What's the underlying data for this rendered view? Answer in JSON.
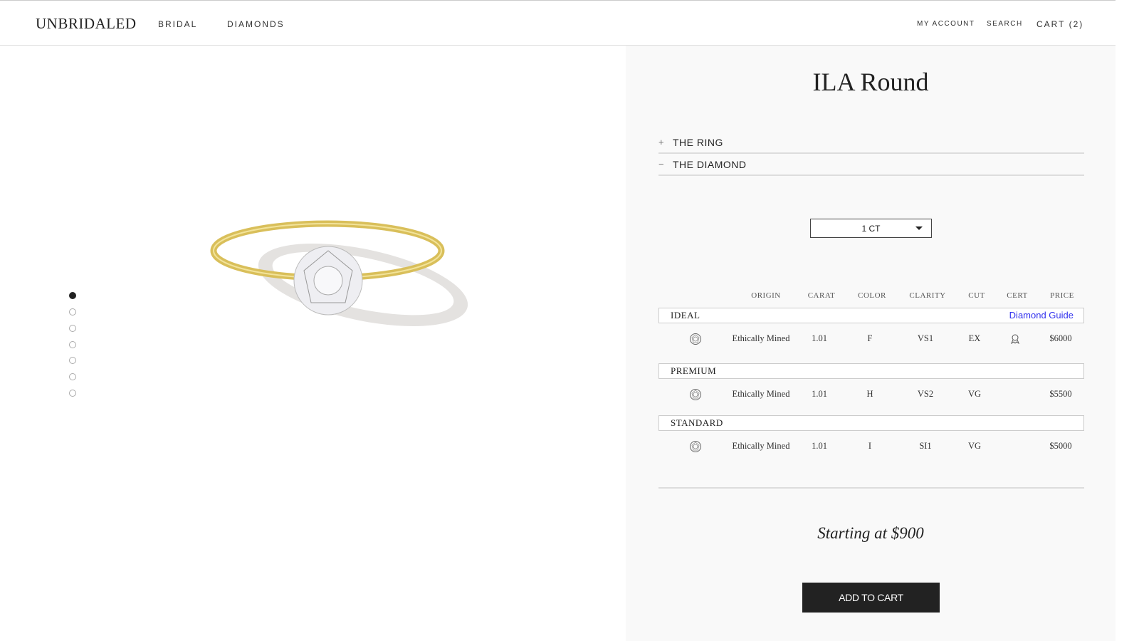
{
  "header": {
    "logo": "UNBRIDALED",
    "nav": [
      "BRIDAL",
      "DIAMONDS"
    ],
    "account": "MY ACCOUNT",
    "search": "SEARCH",
    "cart": "CART (2)"
  },
  "gallery": {
    "image_count": 7,
    "active_index": 0
  },
  "product": {
    "title": "ILA Round",
    "accordion": [
      {
        "sign": "+",
        "label": "THE RING"
      },
      {
        "sign": "−",
        "label": "THE DIAMOND"
      }
    ],
    "carat_select": "1 CT",
    "columns": [
      "ORIGIN",
      "CARAT",
      "COLOR",
      "CLARITY",
      "CUT",
      "CERT",
      "PRICE"
    ],
    "diamond_guide": "Diamond Guide",
    "groups": [
      {
        "name": "IDEAL",
        "row": {
          "icon": "diamond-icon",
          "origin": "Ethically Mined",
          "carat": "1.01",
          "color": "F",
          "clarity": "VS1",
          "cut": "EX",
          "cert": "certificate-ribbon-icon",
          "price": "$6000"
        }
      },
      {
        "name": "PREMIUM",
        "row": {
          "icon": "diamond-icon",
          "origin": "Ethically Mined",
          "carat": "1.01",
          "color": "H",
          "clarity": "VS2",
          "cut": "VG",
          "cert": "",
          "price": "$5500"
        }
      },
      {
        "name": "STANDARD",
        "row": {
          "icon": "diamond-icon",
          "origin": "Ethically Mined",
          "carat": "1.01",
          "color": "I",
          "clarity": "SI1",
          "cut": "VG",
          "cert": "",
          "price": "$5000"
        }
      }
    ],
    "starting_price": "Starting at $900",
    "add_to_cart": "ADD TO CART"
  },
  "colors": {
    "link": "#3333ee",
    "button": "#222222",
    "gold": "#d9bf5a"
  }
}
